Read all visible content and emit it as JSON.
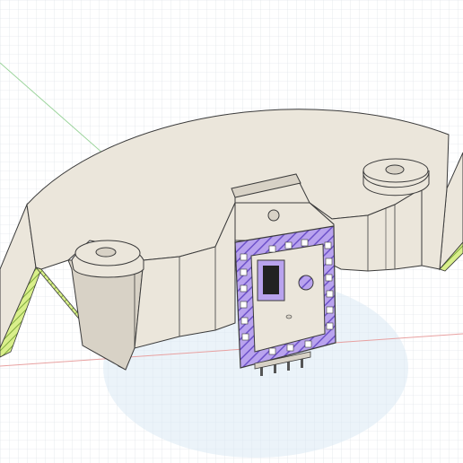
{
  "viewport": {
    "background": "#ffffff",
    "grid_color": "#d7dde3",
    "grid_major_color": "#c4ccd5",
    "axis_red_color": "#e8a0a0",
    "axis_green_color": "#9bd49b",
    "ground_shadow_color": "#dbe9f4"
  },
  "model": {
    "shell_color": "#ebe6db",
    "shell_dark_color": "#d8d2c6",
    "edge_color": "#3b3b3b",
    "section_fill_color": "#b9a3ee",
    "section_hatch_color": "#6d52c9",
    "cut_face_color": "#d9ef8b",
    "cut_hatch_color": "#7da83a",
    "chip_color": "#222222",
    "pin_color": "#555555"
  }
}
